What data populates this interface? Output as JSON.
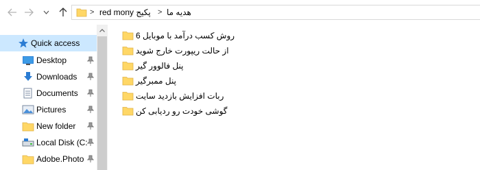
{
  "nav": {
    "back_icon": "arrow-left-icon",
    "forward_icon": "arrow-right-icon",
    "recent_icon": "chevron-down-icon",
    "up_icon": "arrow-up-icon"
  },
  "address": {
    "crumbs": [
      "red mony پکیج",
      "هدیه ما"
    ],
    "separator": ">"
  },
  "sidebar": {
    "items": [
      {
        "label": "Quick access",
        "icon": "star-icon",
        "selected": true
      },
      {
        "label": "Desktop",
        "icon": "desktop-icon",
        "pinned": true
      },
      {
        "label": "Downloads",
        "icon": "download-icon",
        "pinned": true
      },
      {
        "label": "Documents",
        "icon": "documents-icon",
        "pinned": true
      },
      {
        "label": "Pictures",
        "icon": "pictures-icon",
        "pinned": true
      },
      {
        "label": "New folder",
        "icon": "folder-icon",
        "pinned": true
      },
      {
        "label": "Local Disk (C:",
        "icon": "drive-icon",
        "pinned": true
      },
      {
        "label": "Adobe.Photo",
        "icon": "folder-icon",
        "pinned": true
      }
    ]
  },
  "files": [
    {
      "name": "روش کسب درآمد با موبایل 6"
    },
    {
      "name": "از حالت ریپورت خارج شوید"
    },
    {
      "name": "پنل فالوور گیر"
    },
    {
      "name": "پنل ممبرگیر"
    },
    {
      "name": "ربات افزایش بازدید سایت"
    },
    {
      "name": "گوشی خودت رو ردیابی کن"
    }
  ],
  "colors": {
    "selected_bg": "#cce8ff",
    "folder_yellow": "#ffd766",
    "folder_dark": "#e6b33c"
  }
}
